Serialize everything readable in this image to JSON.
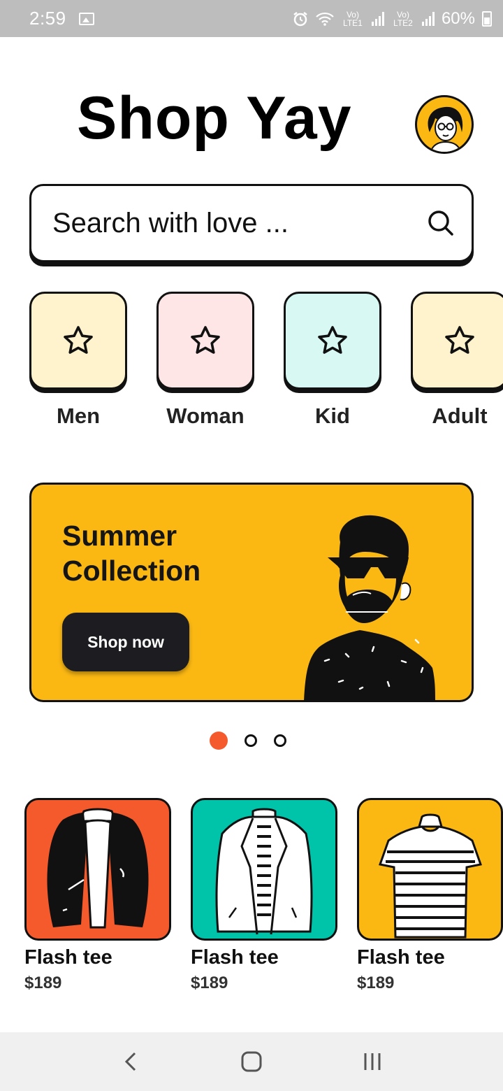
{
  "status_bar": {
    "time": "2:59",
    "signal_1_label": "Vo) LTE1",
    "signal_2_label": "Vo) LTE2",
    "battery": "60%"
  },
  "header": {
    "title": "Shop Yay"
  },
  "search": {
    "placeholder": "Search with love ..."
  },
  "categories": [
    {
      "label": "Men",
      "color": "#fff3cd"
    },
    {
      "label": "Woman",
      "color": "#ffe6e6"
    },
    {
      "label": "Kid",
      "color": "#d8f8f4"
    },
    {
      "label": "Adult",
      "color": "#fff3cd"
    }
  ],
  "banner": {
    "heading_line1": "Summer",
    "heading_line2": "Collection",
    "cta_label": "Shop now",
    "color": "#fbb813"
  },
  "carousel": {
    "total": 3,
    "active_index": 0,
    "active_color": "#f45a2c"
  },
  "products": [
    {
      "name": "Flash tee",
      "price": "$189",
      "color": "#f45a2c",
      "icon": "leather-jacket-icon"
    },
    {
      "name": "Flash tee",
      "price": "$189",
      "color": "#00c4aa",
      "icon": "blazer-icon"
    },
    {
      "name": "Flash tee",
      "price": "$189",
      "color": "#fbb813",
      "icon": "striped-tee-icon"
    }
  ]
}
